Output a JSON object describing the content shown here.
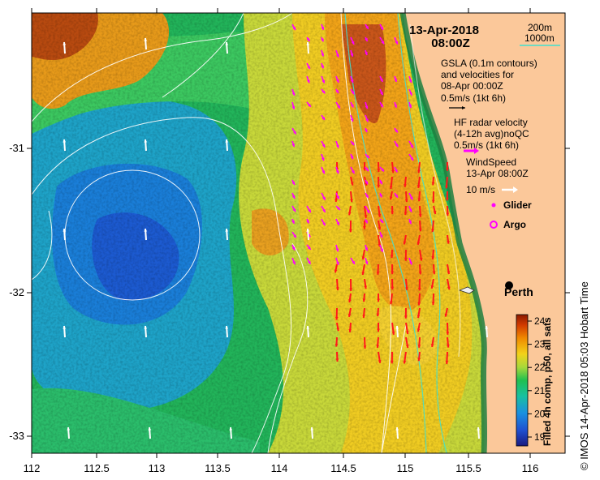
{
  "date_title": "13-Apr-2018",
  "time_title": "08:00Z",
  "depth_legend": {
    "d200": "200m",
    "d1000": "1000m",
    "color200": "#ffffff",
    "color1000": "#40e0d0"
  },
  "gsla_text": [
    "GSLA (0.1m contours)",
    "and velocities for",
    "08-Apr 00:00Z",
    "0.5m/s (1kt 6h)"
  ],
  "hf_text": [
    "HF radar velocity",
    "(4-12h avg)noQC",
    "0.5m/s (1kt 6h)"
  ],
  "wind_text": [
    "WindSpeed",
    "13-Apr 08:00Z",
    "10 m/s"
  ],
  "glider_label": "Glider",
  "argo_label": "Argo",
  "city_label": "Perth",
  "credit": "© IMOS 14-Apr-2018 05:03 Hobart Time",
  "colorbar": {
    "title": "Filled 4h comp, p50, all sats",
    "ticks": [
      "24",
      "23",
      "22",
      "21",
      "20",
      "19"
    ],
    "colors": [
      "#8b1a00",
      "#d23a00",
      "#f08a00",
      "#f2d21a",
      "#a8d83a",
      "#20c050",
      "#18c0a0",
      "#1a90e0",
      "#2050d0",
      "#1a1a80"
    ]
  },
  "x_ticks": [
    "112",
    "112.5",
    "113",
    "113.5",
    "114",
    "114.5",
    "115",
    "115.5",
    "116"
  ],
  "y_ticks": [
    "-31",
    "-32",
    "-33"
  ],
  "colors": {
    "land": "#fbc89a",
    "coast": "#2f8f4f",
    "hf_arrow": "#ff1a1a",
    "gsla_arrow": "#ff00ff",
    "wind_arrow": "#ffffff"
  }
}
